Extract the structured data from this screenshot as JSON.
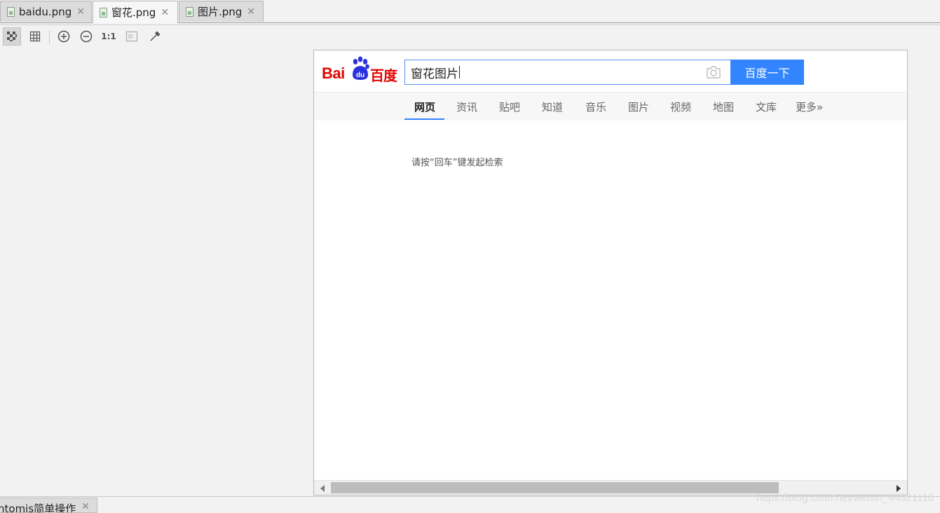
{
  "tabs": [
    {
      "label": "baidu.png",
      "active": false
    },
    {
      "label": "窗花.png",
      "active": true
    },
    {
      "label": "图片.png",
      "active": false
    }
  ],
  "toolbar": {
    "items": [
      "checkerboard-icon",
      "grid-icon",
      "zoom-in-icon",
      "zoom-out-icon",
      "actual-size",
      "fit-window-icon",
      "color-picker-icon"
    ],
    "actual_size_label": "1:1"
  },
  "baidu": {
    "logo_latin": "Bai",
    "logo_du": "du",
    "logo_cn": "百度",
    "search_value": "窗花图片",
    "search_button": "百度一下",
    "nav": [
      "网页",
      "资讯",
      "贴吧",
      "知道",
      "音乐",
      "图片",
      "视频",
      "地图",
      "文库",
      "更多»"
    ],
    "active_nav": "网页",
    "hint": "请按“回车”键发起检索",
    "colors": {
      "brand_red": "#e10602",
      "brand_blue": "#2932e1",
      "button_blue": "#3385ff"
    }
  },
  "bottom_panel": {
    "tab_label": "ntomis简单操作"
  },
  "watermark": "https://blog.csdn.net/weixin_44321116"
}
